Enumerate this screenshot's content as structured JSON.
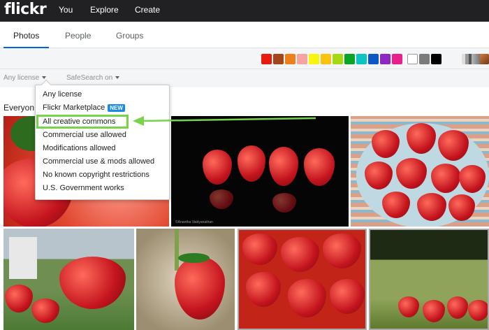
{
  "topbar": {
    "logo": "flickr",
    "nav": [
      "You",
      "Explore",
      "Create"
    ]
  },
  "tabs": {
    "items": [
      "Photos",
      "People",
      "Groups"
    ],
    "active": "Photos"
  },
  "filters": {
    "colors": [
      "#e81b0f",
      "#a3461a",
      "#ef7f1a",
      "#f7a2a3",
      "#f7f40d",
      "#fcc212",
      "#a6d814",
      "#09a524",
      "#0bc5c5",
      "#0c59c4",
      "#8f28c3",
      "#e91f8e",
      "#ffffff",
      "#7b7b7b",
      "#000000"
    ],
    "icons": [
      "black-white-icon",
      "shallow-depth-icon",
      "minimalist-icon",
      "patterns-icon"
    ]
  },
  "options": {
    "license_label": "Any license",
    "safesearch_label": "SafeSearch on"
  },
  "section_label": "Everyon",
  "license_menu": {
    "items": [
      "Any license",
      "Flickr Marketplace",
      "All creative commons",
      "Commercial use allowed",
      "Modifications allowed",
      "Commercial use & mods allowed",
      "No known copyright restrictions",
      "U.S. Government works"
    ],
    "new_badge": "NEW",
    "highlighted": "All creative commons"
  },
  "photos": {
    "watermark": "©Anantha Vaidyanathan"
  },
  "accent": {
    "highlight_color": "#78d24a",
    "brand_blue": "#0063dc"
  }
}
